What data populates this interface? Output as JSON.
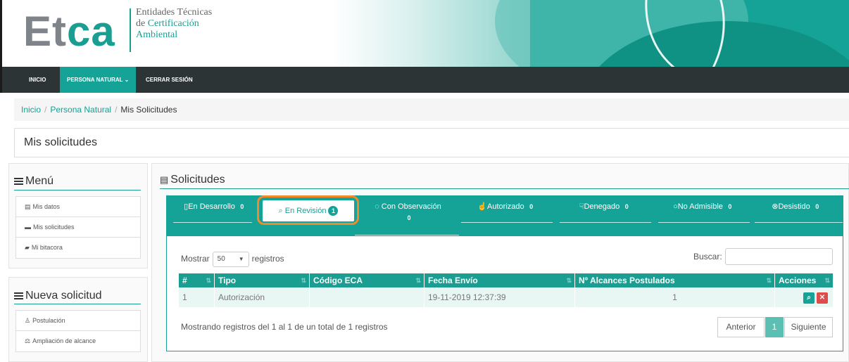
{
  "brand": {
    "logo_e": "E",
    "logo_t": "t",
    "logo_ca": "ca",
    "line1": "Entidades Técnicas",
    "line2_prefix": "de ",
    "line2_accent": "Certificación",
    "line3": "Ambiental"
  },
  "nav": {
    "inicio": "INICIO",
    "persona": "PERSONA NATURAL",
    "persona_caret": "⌄",
    "cerrar": "CERRAR SESIÓN"
  },
  "breadcrumb": {
    "home": "Inicio",
    "section": "Persona Natural",
    "current": "Mis Solicitudes",
    "sep": "/"
  },
  "page_title": "Mis solicitudes",
  "sidebar": {
    "menu_title": "Menú",
    "menu_items": [
      {
        "icon": "▤",
        "label": "Mis datos"
      },
      {
        "icon": "▬",
        "label": "Mis solicitudes"
      },
      {
        "icon": "▰",
        "label": "Mi bitacora"
      }
    ],
    "nueva_title": "Nueva solicitud",
    "nueva_items": [
      {
        "icon": "♙",
        "label": "Postulación"
      },
      {
        "icon": "⚖",
        "label": "Ampliación de alcance"
      }
    ]
  },
  "main": {
    "title": "Solicitudes",
    "title_icon": "▤",
    "tabs": [
      {
        "icon": "▯",
        "label": "En Desarrollo",
        "count": "0"
      },
      {
        "icon": "⌕",
        "label": "En Revisión",
        "count": "1"
      },
      {
        "icon": "◌",
        "label": "Con Observación",
        "count": "0"
      },
      {
        "icon": "☝",
        "label": "Autorizado",
        "count": "0"
      },
      {
        "icon": "☟",
        "label": "Denegado",
        "count": "0"
      },
      {
        "icon": "○",
        "label": "No Admisible",
        "count": "0"
      },
      {
        "icon": "⊗",
        "label": "Desistido",
        "count": "0"
      }
    ],
    "show_prefix": "Mostrar",
    "show_value": "50",
    "show_arrow": "▼",
    "show_suffix": "registros",
    "search_label": "Buscar:",
    "search_value": "",
    "columns": [
      "#",
      "Tipo",
      "Código ECA",
      "Fecha Envío",
      "Nº Alcances Postulados",
      "Acciones"
    ],
    "sort_icon": "⇅",
    "rows": [
      {
        "n": "1",
        "tipo": "Autorización",
        "codigo": "",
        "fecha": "19-11-2019 12:37:39",
        "alcances": "1"
      }
    ],
    "view_icon": "⌕",
    "delete_icon": "✕",
    "info": "Mostrando registros del 1 al 1 de un total de 1 registros",
    "pager": {
      "prev": "Anterior",
      "current": "1",
      "next": "Siguiente"
    }
  },
  "colors": {
    "accent": "#15a397",
    "highlight": "#f08a2a",
    "nav_bg": "#2d3436"
  }
}
